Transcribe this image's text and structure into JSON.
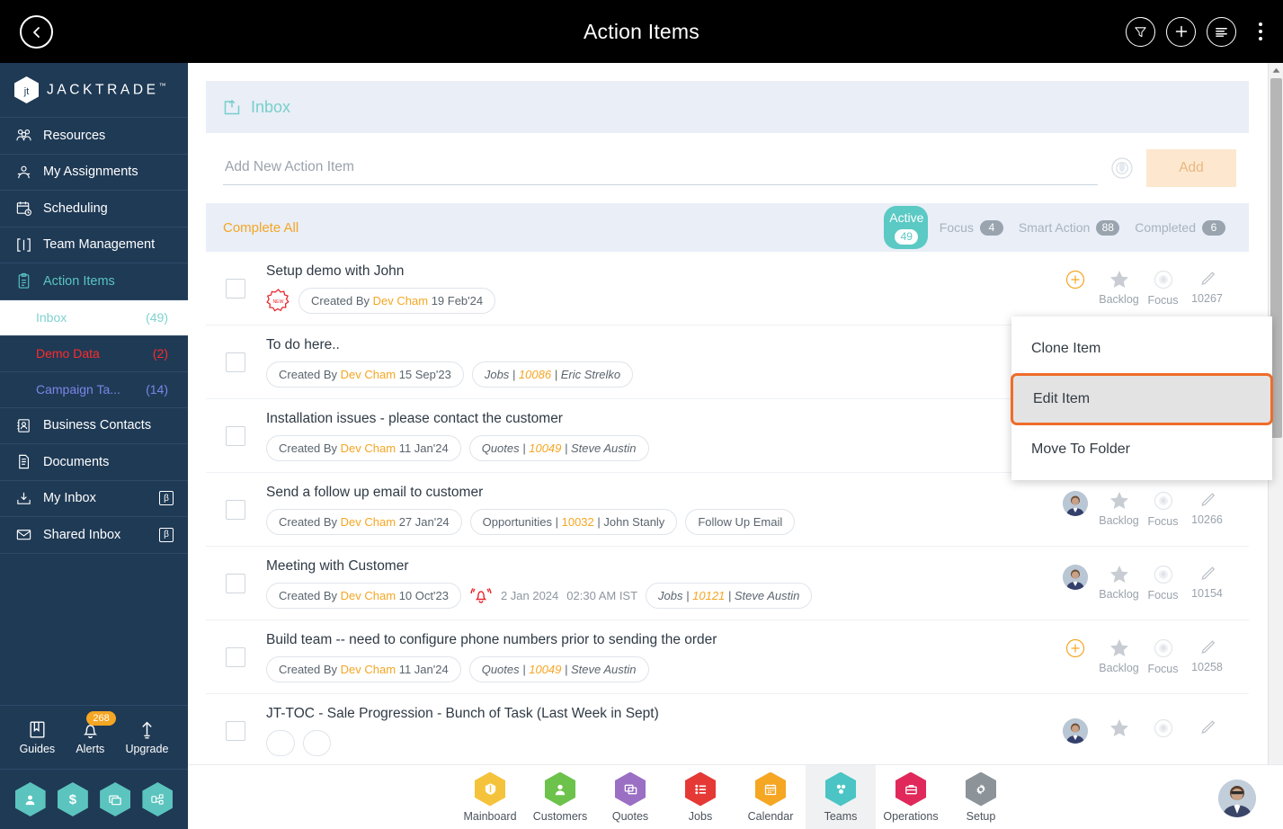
{
  "topbar": {
    "title": "Action Items",
    "back_icon": "chevron-left-icon",
    "actions": [
      {
        "name": "filter-icon",
        "glyph": "funnel"
      },
      {
        "name": "add-icon",
        "glyph": "plus"
      },
      {
        "name": "list-view-icon",
        "glyph": "lines"
      },
      {
        "name": "more-options-icon",
        "glyph": "kebab"
      }
    ]
  },
  "sidebar": {
    "brand": {
      "text": "JACKTRADE",
      "tm": "™",
      "logo": "jacktrade-logo-icon"
    },
    "items": [
      {
        "label": "Resources",
        "icon": "resources-icon",
        "active": false,
        "beta": false
      },
      {
        "label": "My Assignments",
        "icon": "assignments-icon",
        "active": false,
        "beta": false
      },
      {
        "label": "Scheduling",
        "icon": "scheduling-icon",
        "active": false,
        "beta": false
      },
      {
        "label": "Team Management",
        "icon": "team-management-icon",
        "active": false,
        "beta": false
      },
      {
        "label": "Action Items",
        "icon": "action-items-icon",
        "active": true,
        "beta": false
      }
    ],
    "sub_items": [
      {
        "label": "Inbox",
        "count": "(49)",
        "state": "selected"
      },
      {
        "label": "Demo Data",
        "count": "(2)",
        "state": "red"
      },
      {
        "label": "Campaign Ta...",
        "count": "(14)",
        "state": "violet"
      }
    ],
    "items_lower": [
      {
        "label": "Business Contacts",
        "icon": "business-contacts-icon",
        "beta": false
      },
      {
        "label": "Documents",
        "icon": "documents-icon",
        "beta": false
      },
      {
        "label": "My Inbox",
        "icon": "my-inbox-icon",
        "beta": true,
        "beta_label": "β"
      },
      {
        "label": "Shared Inbox",
        "icon": "shared-inbox-icon",
        "beta": true,
        "beta_label": "β"
      }
    ],
    "utils": [
      {
        "label": "Guides",
        "icon": "guides-book-icon",
        "badge": ""
      },
      {
        "label": "Alerts",
        "icon": "bell-icon",
        "badge": "268"
      },
      {
        "label": "Upgrade",
        "icon": "upgrade-arrow-icon",
        "badge": ""
      }
    ],
    "quick_hex": [
      {
        "name": "profile-hex-icon",
        "glyph": "P"
      },
      {
        "name": "billing-hex-icon",
        "glyph": "$"
      },
      {
        "name": "messages-hex-icon",
        "glyph": "⧉"
      },
      {
        "name": "workflow-hex-icon",
        "glyph": "⌘"
      }
    ]
  },
  "inbox": {
    "header_label": "Inbox",
    "header_icon": "inbox-tray-icon",
    "add_placeholder": "Add New Action Item",
    "add_value": "",
    "mic_icon": "voice-input-icon",
    "add_button": "Add",
    "complete_all": "Complete All",
    "tabs": [
      {
        "label": "Active",
        "count": "49",
        "active": true
      },
      {
        "label": "Focus",
        "count": "4",
        "active": false
      },
      {
        "label": "Smart Action",
        "count": "88",
        "active": false
      },
      {
        "label": "Completed",
        "count": "6",
        "active": false
      }
    ]
  },
  "rows": [
    {
      "title": "Setup demo with John",
      "new_badge": "NEW",
      "chips": [
        {
          "type": "created",
          "prefix": "Created By ",
          "who": "Dev Cham",
          "date": " 19 Feb'24"
        }
      ],
      "avatar": false,
      "plus": true,
      "actions": {
        "backlog": "Backlog",
        "focus": "Focus",
        "id": "10267"
      }
    },
    {
      "title": "To do here..",
      "new_badge": "",
      "chips": [
        {
          "type": "created",
          "prefix": "Created By ",
          "who": "Dev Cham",
          "date": " 15 Sep'23"
        },
        {
          "type": "ref",
          "kind": "Jobs",
          "num": "10086",
          "person": "Eric Strelko"
        }
      ],
      "avatar": false,
      "plus": false,
      "actions": {
        "backlog": "",
        "focus": "",
        "id": ""
      }
    },
    {
      "title": "Installation issues - please contact the customer",
      "new_badge": "",
      "chips": [
        {
          "type": "created",
          "prefix": "Created By ",
          "who": "Dev Cham",
          "date": " 11 Jan'24"
        },
        {
          "type": "ref",
          "kind": "Quotes",
          "num": "10049",
          "person": "Steve Austin"
        }
      ],
      "avatar": false,
      "plus": false,
      "actions": {
        "backlog": "",
        "focus": "",
        "id": ""
      }
    },
    {
      "title": "Send a follow up email to customer",
      "new_badge": "",
      "chips": [
        {
          "type": "created",
          "prefix": "Created By ",
          "who": "Dev Cham",
          "date": " 27 Jan'24"
        },
        {
          "type": "ref2",
          "kind": "Opportunities",
          "num": "10032",
          "person": "John Stanly"
        },
        {
          "type": "plain",
          "text": "Follow Up Email"
        }
      ],
      "avatar": true,
      "plus": false,
      "actions": {
        "backlog": "Backlog",
        "focus": "Focus",
        "id": "10266"
      }
    },
    {
      "title": "Meeting with Customer",
      "new_badge": "",
      "chips": [
        {
          "type": "created",
          "prefix": "Created By ",
          "who": "Dev Cham",
          "date": " 10 Oct'23"
        },
        {
          "type": "alarm",
          "date": "2 Jan 2024",
          "time": "02:30 AM IST"
        },
        {
          "type": "ref",
          "kind": "Jobs",
          "num": "10121",
          "person": "Steve Austin"
        }
      ],
      "avatar": true,
      "plus": false,
      "actions": {
        "backlog": "Backlog",
        "focus": "Focus",
        "id": "10154"
      }
    },
    {
      "title": "Build team -- need to configure phone numbers prior to sending the order",
      "new_badge": "",
      "chips": [
        {
          "type": "created",
          "prefix": "Created By ",
          "who": "Dev Cham",
          "date": " 11 Jan'24"
        },
        {
          "type": "ref",
          "kind": "Quotes",
          "num": "10049",
          "person": "Steve Austin"
        }
      ],
      "avatar": false,
      "plus": true,
      "actions": {
        "backlog": "Backlog",
        "focus": "Focus",
        "id": "10258"
      }
    },
    {
      "title": "JT-TOC - Sale Progression - Bunch of Task (Last Week in Sept)",
      "new_badge": "",
      "chips": [],
      "avatar": true,
      "plus": false,
      "actions": {
        "backlog": "",
        "focus": "",
        "id": ""
      }
    }
  ],
  "context_menu": {
    "items": [
      {
        "label": "Clone Item",
        "highlighted": false
      },
      {
        "label": "Edit Item",
        "highlighted": true
      },
      {
        "label": "Move To Folder",
        "highlighted": false
      }
    ],
    "highlight_color": "#ef6c2a"
  },
  "bottom_nav": {
    "items": [
      {
        "label": "Mainboard",
        "color": "#f5c33b",
        "icon": "mainboard-icon",
        "active": false
      },
      {
        "label": "Customers",
        "color": "#6cc24a",
        "icon": "customers-icon",
        "active": false
      },
      {
        "label": "Quotes",
        "color": "#9b6fc4",
        "icon": "quotes-icon",
        "active": false
      },
      {
        "label": "Jobs",
        "color": "#e53935",
        "icon": "jobs-icon",
        "active": false
      },
      {
        "label": "Calendar",
        "color": "#f5a623",
        "icon": "calendar-icon",
        "active": false
      },
      {
        "label": "Teams",
        "color": "#4ac4c4",
        "icon": "teams-icon",
        "active": true
      },
      {
        "label": "Operations",
        "color": "#e0295a",
        "icon": "operations-icon",
        "active": false
      },
      {
        "label": "Setup",
        "color": "#8d9499",
        "icon": "setup-gear-icon",
        "active": false
      }
    ],
    "avatar": "user-avatar"
  },
  "scrollbar": {
    "up": "▲",
    "down": "▼"
  }
}
